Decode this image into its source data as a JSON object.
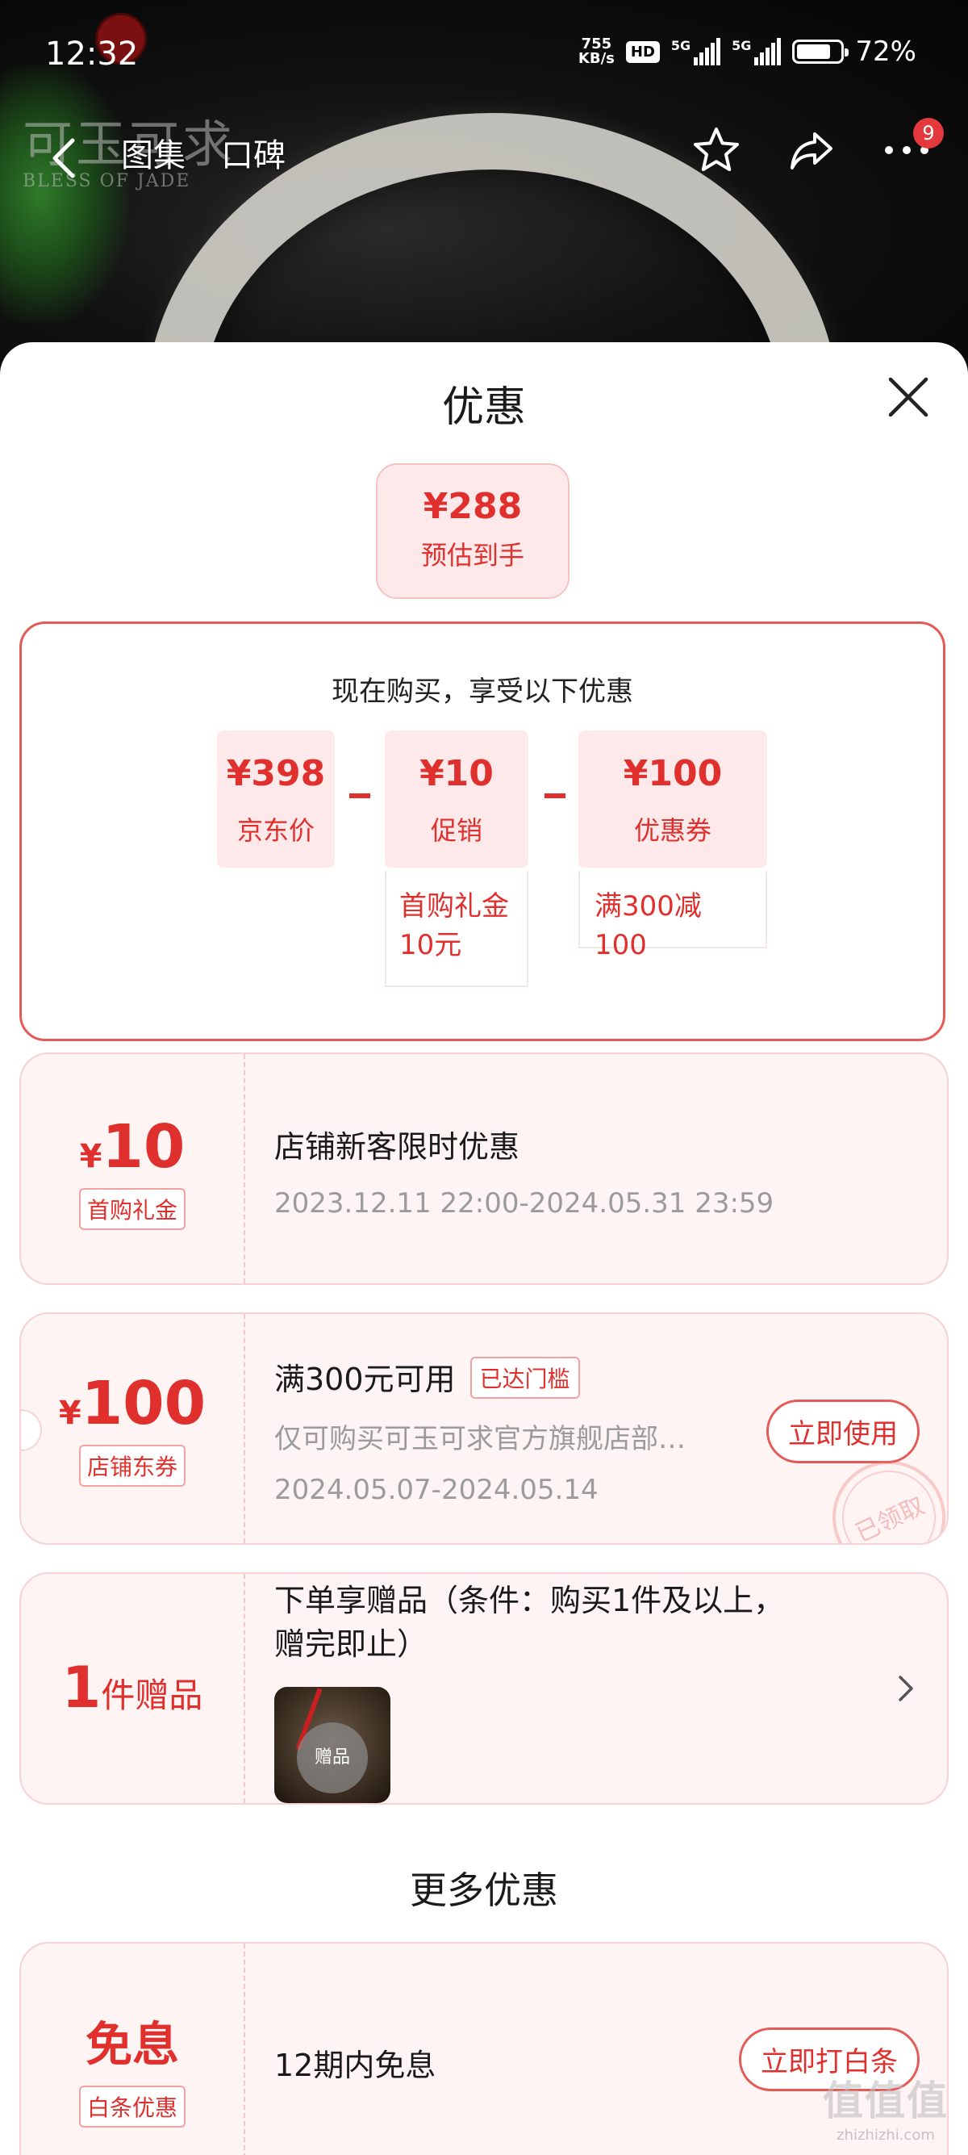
{
  "status_bar": {
    "time": "12:32",
    "speed_top": "755",
    "speed_bottom": "KB/s",
    "hd": "HD",
    "sig1": "5G",
    "sig2": "5G",
    "battery": "72%"
  },
  "hero": {
    "brand_cn": "可玉可求",
    "brand_en": "BLESS OF JADE"
  },
  "nav": {
    "tabs": [
      "图集",
      "口碑"
    ],
    "message_badge": "9"
  },
  "sheet": {
    "title": "优惠",
    "estimate": {
      "amount": "¥288",
      "label": "预估到手"
    },
    "calc": {
      "intro": "现在购买，享受以下优惠",
      "items": [
        {
          "value": "¥398",
          "label": "京东价"
        },
        {
          "value": "¥10",
          "label": "促销",
          "detail": "首购礼金10元"
        },
        {
          "value": "¥100",
          "label": "优惠券",
          "detail": "满300减100"
        }
      ]
    },
    "coupons": [
      {
        "currency": "¥",
        "amount": "10",
        "tag": "首购礼金",
        "title": "店铺新客限时优惠",
        "period": "2023.12.11 22:00-2024.05.31 23:59"
      },
      {
        "currency": "¥",
        "amount": "100",
        "tag": "店铺东券",
        "title": "满300元可用",
        "status": "已达门槛",
        "desc": "仅可购买可玉可求官方旗舰店部…",
        "period": "2024.05.07-2024.05.14",
        "cta": "立即使用",
        "stamp": "已领取"
      }
    ],
    "gift": {
      "count": "1",
      "unit": "件赠品",
      "title": "下单享赠品（条件：购买1件及以上，赠完即止）",
      "thumb_badge": "赠品"
    },
    "more_title": "更多优惠",
    "installment": {
      "amount": "免息",
      "tag": "白条优惠",
      "title": "12期内免息",
      "cta": "立即打白条"
    }
  },
  "watermark": {
    "logo": "值值值",
    "url": "zhizhizhi.com"
  }
}
